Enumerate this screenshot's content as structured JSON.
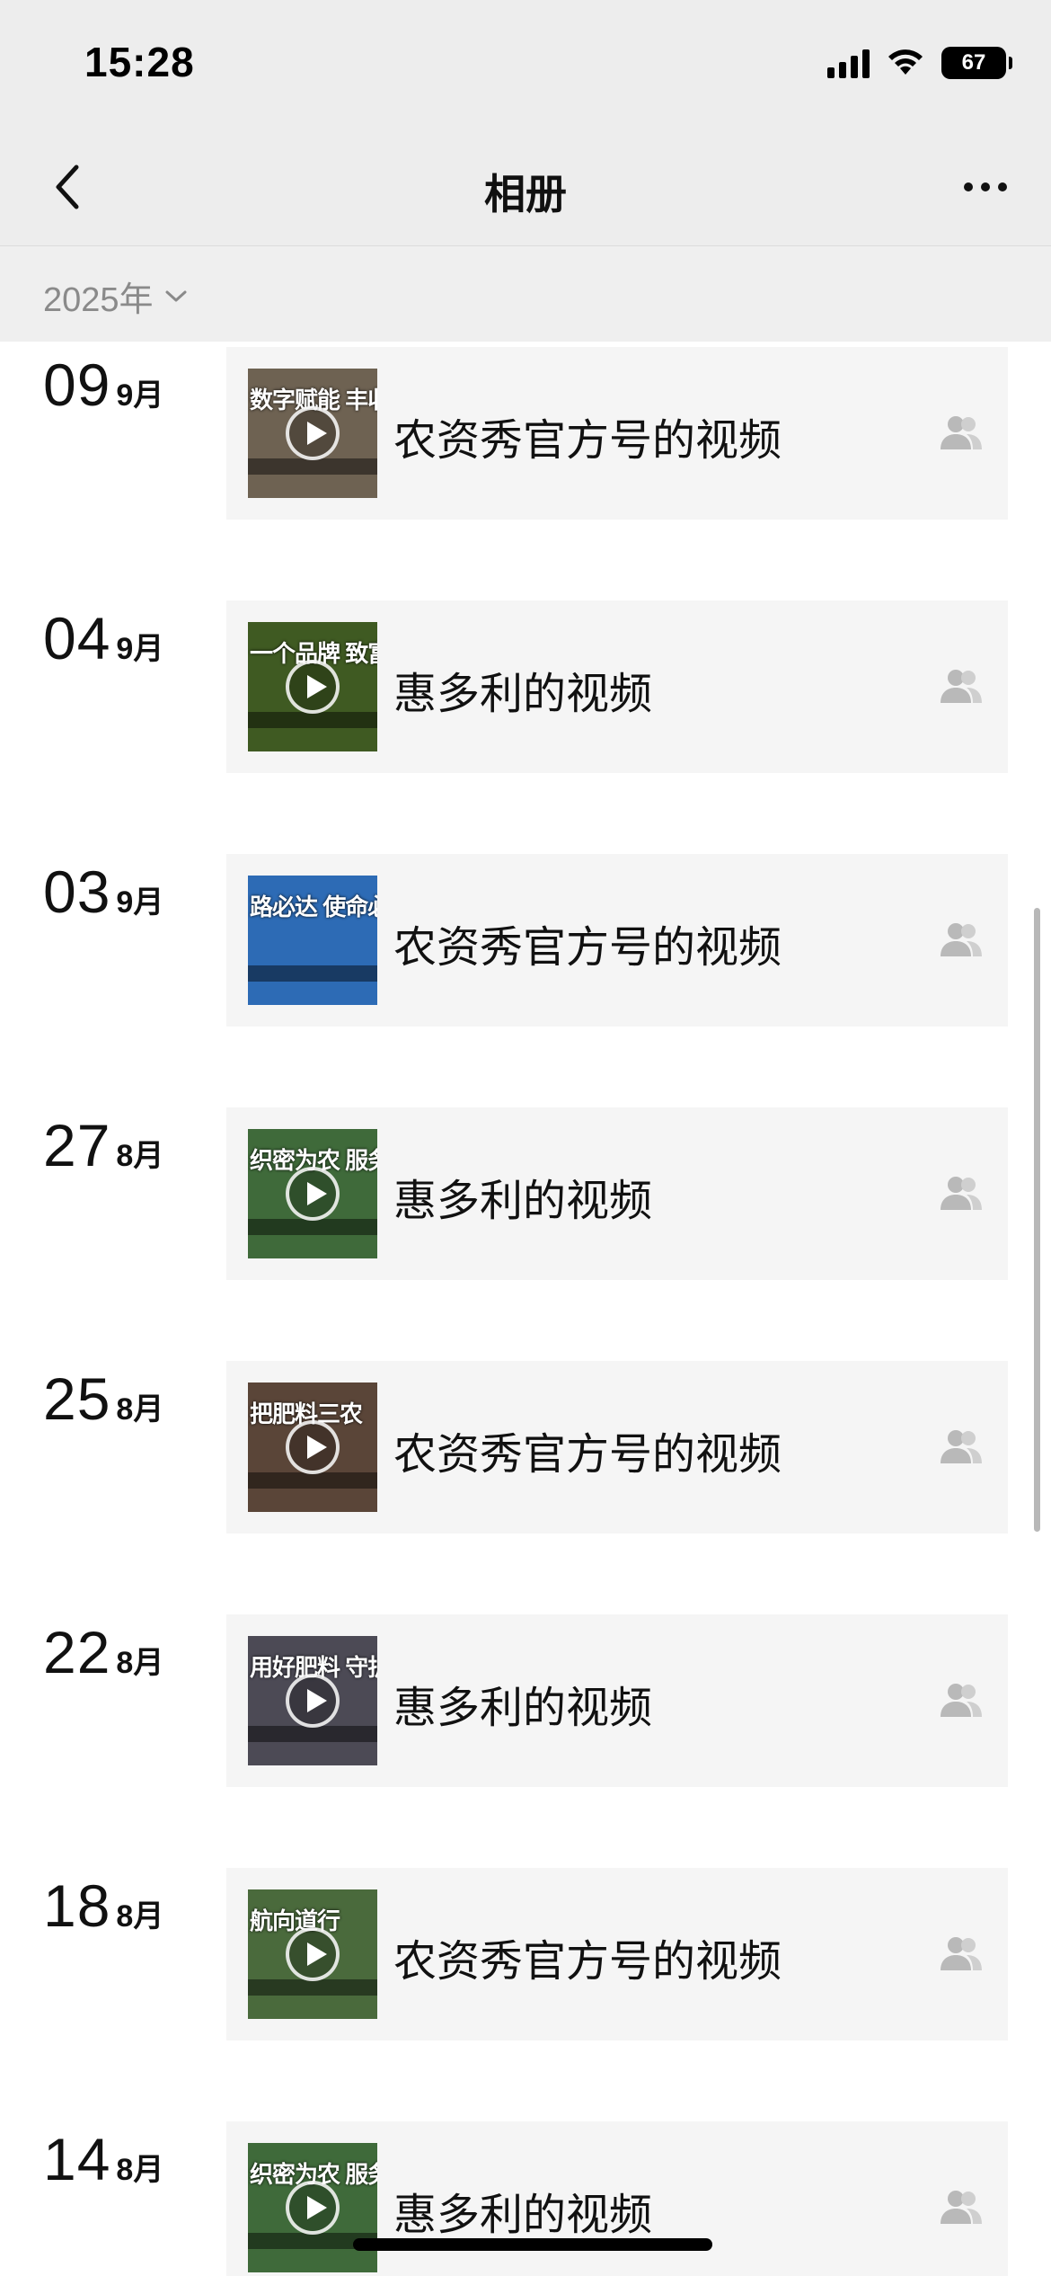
{
  "status_bar": {
    "time": "15:28",
    "battery": "67"
  },
  "nav": {
    "title": "相册"
  },
  "year_selector": {
    "label": "2025年"
  },
  "entries": [
    {
      "day": "09",
      "month": "9月",
      "title": "农资秀官方号的视频",
      "thumb_text": "数字赋能 丰收必路",
      "thumb_bg": "#6e6252"
    },
    {
      "day": "04",
      "month": "9月",
      "title": "惠多利的视频",
      "thumb_text": "一个品牌 致富万家",
      "thumb_bg": "#3f5a22"
    },
    {
      "day": "03",
      "month": "9月",
      "title": "农资秀官方号的视频",
      "thumb_text": "路必达 使命必达",
      "thumb_bg": "#2d6bb5"
    },
    {
      "day": "27",
      "month": "8月",
      "title": "惠多利的视频",
      "thumb_text": "织密为农 服务网络",
      "thumb_bg": "#3f6a3a"
    },
    {
      "day": "25",
      "month": "8月",
      "title": "农资秀官方号的视频",
      "thumb_text": "把肥料三农",
      "thumb_bg": "#5a4538"
    },
    {
      "day": "22",
      "month": "8月",
      "title": "惠多利的视频",
      "thumb_text": "用好肥料 守护中国粮仓",
      "thumb_bg": "#4c4a55"
    },
    {
      "day": "18",
      "month": "8月",
      "title": "农资秀官方号的视频",
      "thumb_text": "航向道行",
      "thumb_bg": "#4a6a3c"
    },
    {
      "day": "14",
      "month": "8月",
      "title": "惠多利的视频",
      "thumb_text": "织密为农 服务网络",
      "thumb_bg": "#3f6a3a"
    }
  ]
}
